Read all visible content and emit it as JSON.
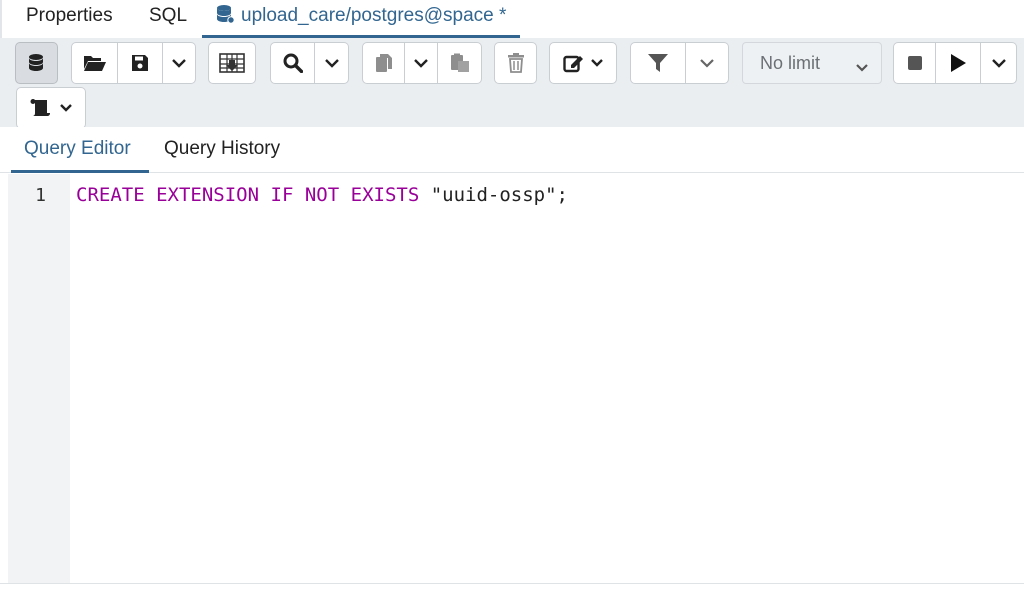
{
  "top_tabs": [
    {
      "label": "Properties"
    },
    {
      "label": "SQL"
    },
    {
      "label": "upload_care/postgres@space *",
      "icon": "database-icon"
    }
  ],
  "toolbar": {
    "limit_select": {
      "value": "No limit"
    },
    "icons": [
      "database-icon",
      "folder-open-icon",
      "save-icon",
      "chevron-down-icon",
      "grid-icon",
      "search-icon",
      "copy-icon",
      "paste-icon",
      "trash-icon",
      "edit-icon",
      "filter-icon",
      "stop-icon",
      "play-icon",
      "scroll-icon"
    ]
  },
  "sub_tabs": [
    {
      "label": "Query Editor"
    },
    {
      "label": "Query History"
    }
  ],
  "editor": {
    "line_number": "1",
    "kw_create": "CREATE",
    "kw_extension": "EXTENSION",
    "kw_if": "IF",
    "kw_not": "NOT",
    "kw_exists": "EXISTS",
    "literal": "\"uuid-ossp\";"
  },
  "colors": {
    "accent": "#326690",
    "keyword": "#990099",
    "toolbar_bg": "#ebeef1"
  }
}
